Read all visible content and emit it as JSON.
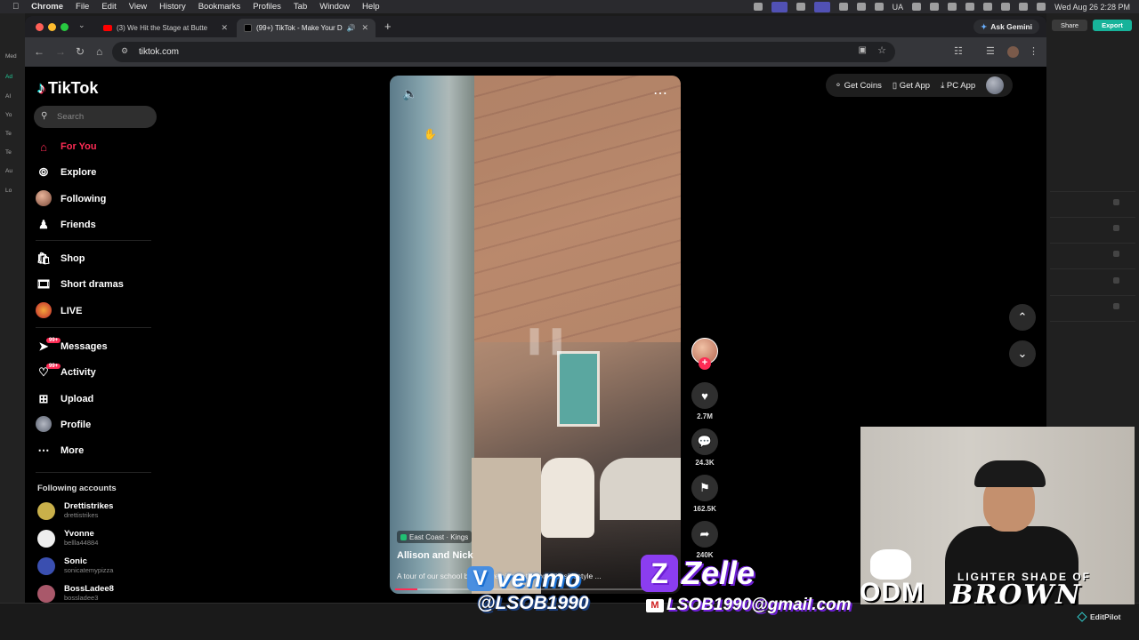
{
  "menubar": {
    "apple": "",
    "items": [
      "Chrome",
      "File",
      "Edit",
      "View",
      "History",
      "Bookmarks",
      "Profiles",
      "Tab",
      "Window",
      "Help"
    ],
    "lang": "UA",
    "clock": "Wed Aug 26  2:28 PM"
  },
  "editor": {
    "share": "Share",
    "export": "Export",
    "left_labels": [
      "Med",
      "Ad",
      "AI",
      "Yo",
      "Te",
      "Te",
      "Au",
      "Lo"
    ],
    "bottom_brand": "EditPilot"
  },
  "browser": {
    "tabs": [
      {
        "title": "(3) We Hit the Stage at Butte",
        "active": false
      },
      {
        "title": "(99+) TikTok - Make Your D",
        "active": true
      }
    ],
    "ask_gemini": "Ask Gemini",
    "url": "tiktok.com"
  },
  "tiktok": {
    "logo": "TikTok",
    "search_placeholder": "Search",
    "nav": [
      {
        "label": "For You",
        "icon": "home-icon"
      },
      {
        "label": "Explore",
        "icon": "compass-icon"
      },
      {
        "label": "Following",
        "icon": "avatar"
      },
      {
        "label": "Friends",
        "icon": "friends-icon"
      },
      {
        "label": "Shop",
        "icon": "bag-icon"
      },
      {
        "label": "Short dramas",
        "icon": "film-icon"
      },
      {
        "label": "LIVE",
        "icon": "live-icon"
      },
      {
        "label": "Messages",
        "icon": "send-icon",
        "badge": "99+"
      },
      {
        "label": "Activity",
        "icon": "bell-icon",
        "badge": "99+"
      },
      {
        "label": "Upload",
        "icon": "plus-square-icon"
      },
      {
        "label": "Profile",
        "icon": "avatar"
      },
      {
        "label": "More",
        "icon": "ellipsis-icon"
      }
    ],
    "following_header": "Following accounts",
    "following": [
      {
        "name": "Drettistrikes",
        "handle": "drettistrikes",
        "color": "#c9b04a"
      },
      {
        "name": "Yvonne",
        "handle": "bellla44884",
        "color": "#eeeeee"
      },
      {
        "name": "Sonic",
        "handle": "sonicatemypizza",
        "color": "#3a4fb0"
      },
      {
        "name": "BossLadee8",
        "handle": "bossladee3",
        "color": "#a9586a"
      }
    ],
    "top_right": {
      "coins": "Get Coins",
      "app": "Get App",
      "pc": "PC App"
    },
    "video": {
      "location": "East Coast · Kings",
      "author": "Allison and Nick",
      "description": "A tour of our school bus conversion bathroom #buslifestyle ...",
      "progress": 0.08
    },
    "actions": {
      "likes": "2.7M",
      "comments": "24.3K",
      "saves": "162.5K",
      "shares": "240K"
    }
  },
  "overlay": {
    "venmo_brand": "venmo",
    "venmo_handle": "@LSOB1990",
    "zelle_brand": "Zelle",
    "zelle_email": "LSOB1990@gmail.com",
    "odm": "ODM",
    "lsob_line1": "LIGHTER SHADE OF",
    "lsob_line2": "BROWN"
  }
}
